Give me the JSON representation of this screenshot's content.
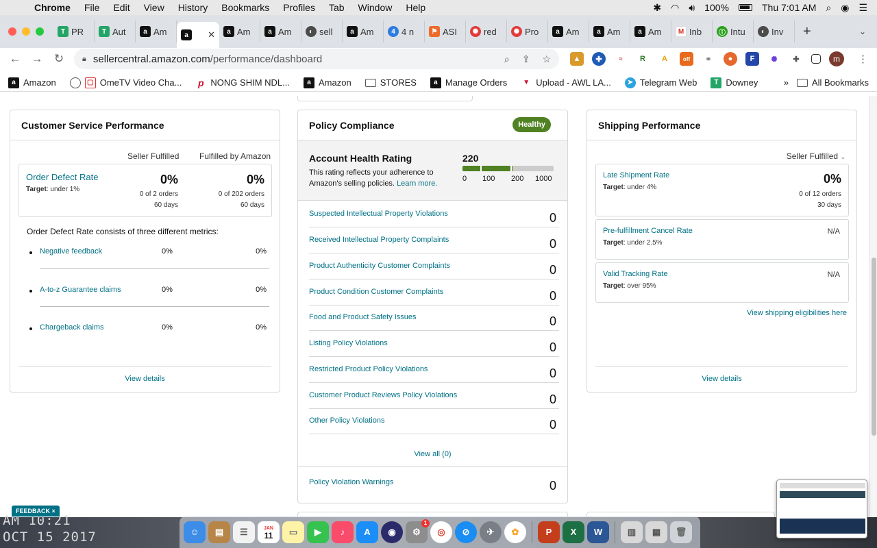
{
  "menubar": {
    "app": "Chrome",
    "items": [
      "File",
      "Edit",
      "View",
      "History",
      "Bookmarks",
      "Profiles",
      "Tab",
      "Window",
      "Help"
    ],
    "battery": "100%",
    "clock": "Thu 7:01 AM"
  },
  "tabs": [
    {
      "label": "PR",
      "icon": "sheets"
    },
    {
      "label": "Aut",
      "icon": "sheets"
    },
    {
      "label": "Am",
      "icon": "amazon"
    },
    {
      "label": "",
      "icon": "amazon",
      "active": true
    },
    {
      "label": "Am",
      "icon": "amazon"
    },
    {
      "label": "Am",
      "icon": "amazon"
    },
    {
      "label": "sell",
      "icon": "generic"
    },
    {
      "label": "Am",
      "icon": "amazon"
    },
    {
      "label": "4 n",
      "icon": "blue"
    },
    {
      "label": "ASI",
      "icon": "orange"
    },
    {
      "label": "red",
      "icon": "red"
    },
    {
      "label": "Pro",
      "icon": "red"
    },
    {
      "label": "Am",
      "icon": "amazon-a"
    },
    {
      "label": "Am",
      "icon": "amazon-a"
    },
    {
      "label": "Am",
      "icon": "amazon-a"
    },
    {
      "label": "Inb",
      "icon": "gmail"
    },
    {
      "label": "Intu",
      "icon": "intuit"
    },
    {
      "label": "Inv",
      "icon": "generic"
    }
  ],
  "address": {
    "host": "sellercentral.amazon.com",
    "path": "/performance/dashboard"
  },
  "bookmarks": [
    {
      "label": "Amazon"
    },
    {
      "label": "OmeTV Video Cha..."
    },
    {
      "label": "NONG SHIM NDL..."
    },
    {
      "label": "Amazon"
    },
    {
      "label": "STORES"
    },
    {
      "label": "Manage Orders"
    },
    {
      "label": "Upload - AWL LA..."
    },
    {
      "label": "Telegram Web"
    },
    {
      "label": "Downey"
    }
  ],
  "bookmarks_more": "»",
  "bookmarks_all": "All Bookmarks",
  "customer_service": {
    "title": "Customer Service Performance",
    "col1": "Seller Fulfilled",
    "col2": "Fulfilled by Amazon",
    "odr": {
      "title": "Order Defect Rate",
      "target_label": "Target",
      "target_value": ": under 1%",
      "seller_pct": "0%",
      "seller_orders": "0 of 2 orders",
      "seller_days": "60 days",
      "fba_pct": "0%",
      "fba_orders": "0 of 202 orders",
      "fba_days": "60 days"
    },
    "description": "Order Defect Rate consists of three different metrics:",
    "metrics": [
      {
        "name": "Negative feedback",
        "seller": "0%",
        "fba": "0%"
      },
      {
        "name": "A-to-z Guarantee claims",
        "seller": "0%",
        "fba": "0%"
      },
      {
        "name": "Chargeback claims",
        "seller": "0%",
        "fba": "0%"
      }
    ],
    "view_details": "View details"
  },
  "policy": {
    "title": "Policy Compliance",
    "badge": "Healthy",
    "ahr_title": "Account Health Rating",
    "ahr_desc": "This rating reflects your adherence to Amazon's selling policies.",
    "learn_more": "Learn more.",
    "score": "220",
    "score_fraction": 0.55,
    "ticks": [
      "0",
      "100",
      "200",
      "1000"
    ],
    "rows": [
      {
        "name": "Suspected Intellectual Property Violations",
        "value": "0"
      },
      {
        "name": "Received Intellectual Property Complaints",
        "value": "0"
      },
      {
        "name": "Product Authenticity Customer Complaints",
        "value": "0"
      },
      {
        "name": "Product Condition Customer Complaints",
        "value": "0"
      },
      {
        "name": "Food and Product Safety Issues",
        "value": "0"
      },
      {
        "name": "Listing Policy Violations",
        "value": "0"
      },
      {
        "name": "Restricted Product Policy Violations",
        "value": "0"
      },
      {
        "name": "Customer Product Reviews Policy Violations",
        "value": "0"
      },
      {
        "name": "Other Policy Violations",
        "value": "0"
      }
    ],
    "view_all": "View all (0)",
    "warnings": {
      "name": "Policy Violation Warnings",
      "value": "0"
    }
  },
  "shipping": {
    "title": "Shipping Performance",
    "selector": "Seller Fulfilled",
    "late": {
      "title": "Late Shipment Rate",
      "target_label": "Target",
      "target_value": ": under 4%",
      "pct": "0%",
      "orders": "0 of 12 orders",
      "days": "30 days"
    },
    "cancel": {
      "title": "Pre-fulfillment Cancel Rate",
      "target_label": "Target",
      "target_value": ": under 2.5%",
      "value": "N/A"
    },
    "tracking": {
      "title": "Valid Tracking Rate",
      "target_label": "Target",
      "target_value": ": over 95%",
      "value": "N/A"
    },
    "eligibilities": "View shipping eligibilities here",
    "view_details": "View details"
  },
  "feedback": "FEEDBACK ×",
  "desktop_stamp": {
    "line1": "AM 10:21",
    "line2": "OCT 15 2017"
  },
  "dock_calendar": {
    "month": "JAN",
    "day": "11"
  },
  "dock_badge": "1"
}
